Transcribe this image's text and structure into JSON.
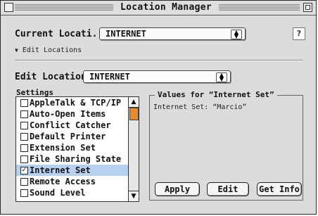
{
  "window": {
    "title": "Location Manager"
  },
  "current_location": {
    "label": "Current Locati...",
    "value": "INTERNET"
  },
  "help": {
    "label": "?"
  },
  "edit_locations": {
    "label": "Edit Locations"
  },
  "edit_location": {
    "label": "Edit Location:",
    "value": "INTERNET"
  },
  "settings": {
    "label": "Settings",
    "items": [
      {
        "label": "AppleTalk & TCP/IP",
        "checked": false
      },
      {
        "label": "Auto-Open Items",
        "checked": false
      },
      {
        "label": "Conflict Catcher",
        "checked": false
      },
      {
        "label": "Default Printer",
        "checked": false
      },
      {
        "label": "Extension Set",
        "checked": false
      },
      {
        "label": "File Sharing State",
        "checked": false
      },
      {
        "label": "Internet Set",
        "checked": true,
        "selected": true
      },
      {
        "label": "Remote Access",
        "checked": false
      },
      {
        "label": "Sound Level",
        "checked": false
      }
    ]
  },
  "values_group": {
    "title": "Values for “Internet Set”",
    "content": "Internet Set: “Marcio”"
  },
  "buttons": {
    "apply": "Apply",
    "edit": "Edit",
    "get_info": "Get Info"
  },
  "colors": {
    "selection": "#b7d0f0",
    "scroll_thumb": "#ea8b2a"
  }
}
